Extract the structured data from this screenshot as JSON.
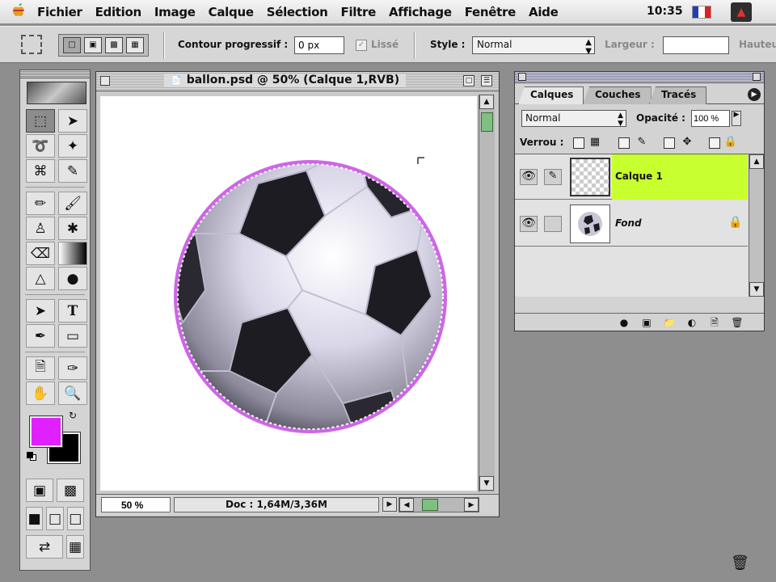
{
  "menubar": {
    "items": [
      "Fichier",
      "Edition",
      "Image",
      "Calque",
      "Sélection",
      "Filtre",
      "Affichage",
      "Fenêtre",
      "Aide"
    ],
    "clock": "10:35",
    "flag_colors": [
      "#1f3fb5",
      "#ffffff",
      "#e02020"
    ]
  },
  "options_bar": {
    "feather_label": "Contour progressif :",
    "feather_value": "0 px",
    "antialias_label": "Lissé",
    "antialias_checked": true,
    "antialias_enabled": false,
    "style_label": "Style :",
    "style_value": "Normal",
    "width_label": "Largeur :",
    "width_value": "",
    "height_label": "Hauteur"
  },
  "document": {
    "title": "ballon.psd @ 50% (Calque 1,RVB)",
    "zoom": "50 %",
    "doc_size": "Doc : 1,64M/3,36M",
    "selection_color": "#c040e0"
  },
  "toolbox": {
    "foreground_color": "#e020ff",
    "background_color": "#000000"
  },
  "layers_panel": {
    "tabs": [
      "Calques",
      "Couches",
      "Tracés"
    ],
    "active_tab": "Calques",
    "blend_mode": "Normal",
    "opacity_label": "Opacité :",
    "opacity_value": "100 %",
    "lock_label": "Verrou :",
    "layers": [
      {
        "name": "Calque 1",
        "selected": true,
        "locked": false
      },
      {
        "name": "Fond",
        "selected": false,
        "locked": true
      }
    ],
    "highlight_color": "#c8ff2e"
  }
}
